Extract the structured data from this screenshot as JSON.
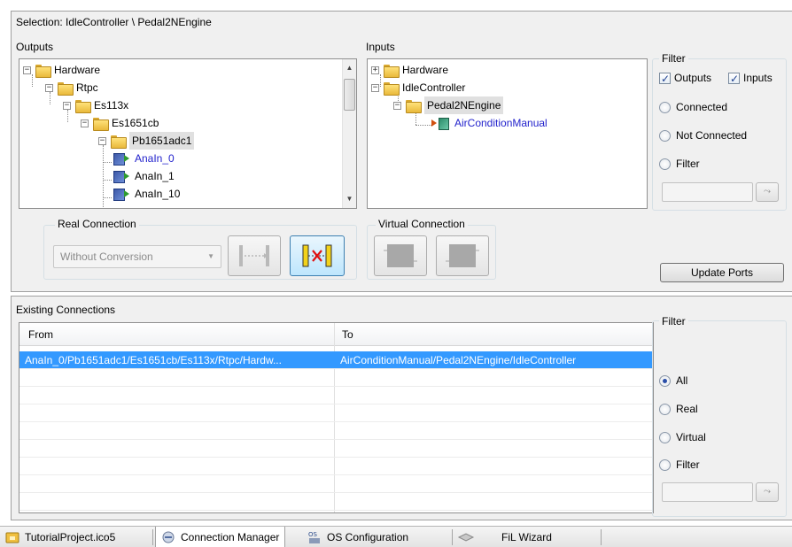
{
  "selection": {
    "label": "Selection: IdleController \\ Pedal2NEngine"
  },
  "outputs": {
    "label": "Outputs",
    "tree": [
      {
        "text": "Hardware"
      },
      {
        "text": "Rtpc"
      },
      {
        "text": "Es113x"
      },
      {
        "text": "Es1651cb"
      },
      {
        "text": "Pb1651adc1"
      },
      {
        "text": "AnaIn_0"
      },
      {
        "text": "AnaIn_1"
      },
      {
        "text": "AnaIn_10"
      }
    ]
  },
  "inputs": {
    "label": "Inputs",
    "tree": [
      {
        "text": "Hardware"
      },
      {
        "text": "IdleController"
      },
      {
        "text": "Pedal2NEngine"
      },
      {
        "text": "AirConditionManual"
      }
    ]
  },
  "filter_top": {
    "title": "Filter",
    "outputs_label": "Outputs",
    "inputs_label": "Inputs",
    "outputs_checked": true,
    "inputs_checked": true,
    "options": [
      "Connected",
      "Not Connected",
      "Filter"
    ],
    "selected": null,
    "apply_icon": "filter-apply-icon"
  },
  "real_connection": {
    "title": "Real Connection",
    "combo_value": "Without Conversion"
  },
  "virtual_connection": {
    "title": "Virtual Connection"
  },
  "update_ports_label": "Update Ports",
  "existing": {
    "label": "Existing Connections",
    "columns": [
      "From",
      "To"
    ],
    "rows": [
      {
        "from": "AnaIn_0/Pb1651adc1/Es1651cb/Es113x/Rtpc/Hardw...",
        "to": "AirConditionManual/Pedal2NEngine/IdleController"
      }
    ]
  },
  "filter_bottom": {
    "title": "Filter",
    "options": [
      "All",
      "Real",
      "Virtual",
      "Filter"
    ],
    "selected": "All"
  },
  "tabs": [
    {
      "label": "TutorialProject.ico5",
      "icon": "project-icon"
    },
    {
      "label": "Connection Manager",
      "icon": "connection-manager-icon",
      "active": true
    },
    {
      "label": "OS Configuration",
      "icon": "os-icon"
    },
    {
      "label": "FiL Wizard",
      "icon": "wizard-icon"
    }
  ],
  "colors": {
    "selection": "#3399ff",
    "link_blue": "#2222cc",
    "folder": "#e9b93b"
  }
}
